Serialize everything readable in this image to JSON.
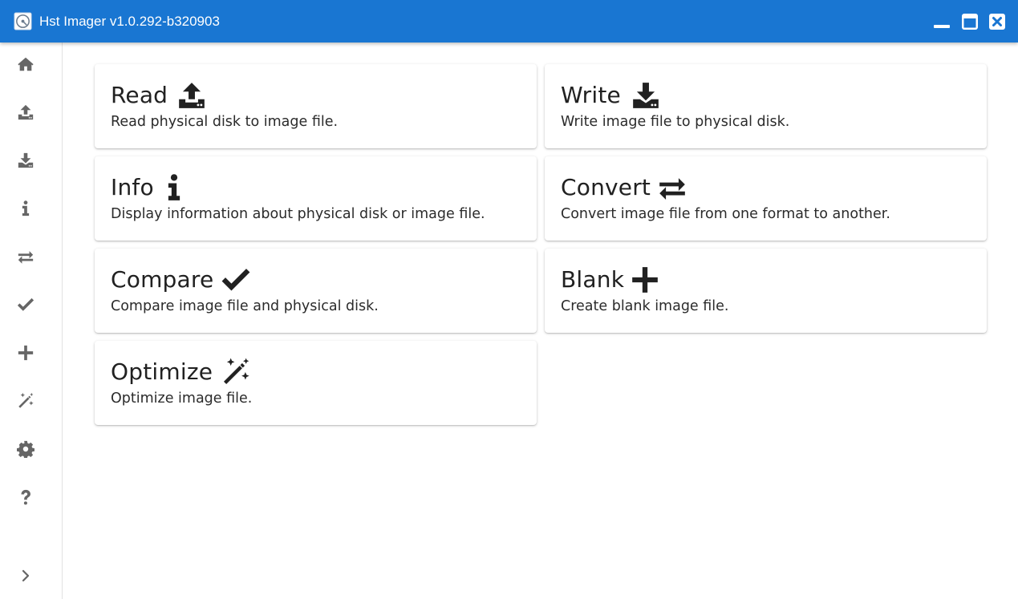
{
  "window": {
    "title": "Hst Imager v1.0.292-b320903",
    "app_icon": "disk-icon",
    "controls": [
      "minimize-icon",
      "maximize-icon",
      "close-icon"
    ],
    "accent": "#1976d2"
  },
  "sidebar": {
    "items": [
      {
        "icon": "home-icon"
      },
      {
        "icon": "upload-icon"
      },
      {
        "icon": "download-icon"
      },
      {
        "icon": "info-icon"
      },
      {
        "icon": "swap-arrows-icon"
      },
      {
        "icon": "check-icon"
      },
      {
        "icon": "plus-icon"
      },
      {
        "icon": "magic-wand-icon"
      },
      {
        "icon": "gear-icon"
      },
      {
        "icon": "question-icon"
      }
    ],
    "expand_icon": "chevron-right-icon"
  },
  "cards": [
    {
      "title": "Read",
      "description": "Read physical disk to image file.",
      "icon": "upload-icon"
    },
    {
      "title": "Write",
      "description": "Write image file to physical disk.",
      "icon": "download-icon"
    },
    {
      "title": "Info",
      "description": "Display information about physical disk or image file.",
      "icon": "info-icon"
    },
    {
      "title": "Convert",
      "description": "Convert image file from one format to another.",
      "icon": "swap-arrows-icon"
    },
    {
      "title": "Compare",
      "description": "Compare image file and physical disk.",
      "icon": "check-icon"
    },
    {
      "title": "Blank",
      "description": "Create blank image file.",
      "icon": "plus-icon"
    },
    {
      "title": "Optimize",
      "description": "Optimize image file.",
      "icon": "magic-wand-icon"
    }
  ]
}
